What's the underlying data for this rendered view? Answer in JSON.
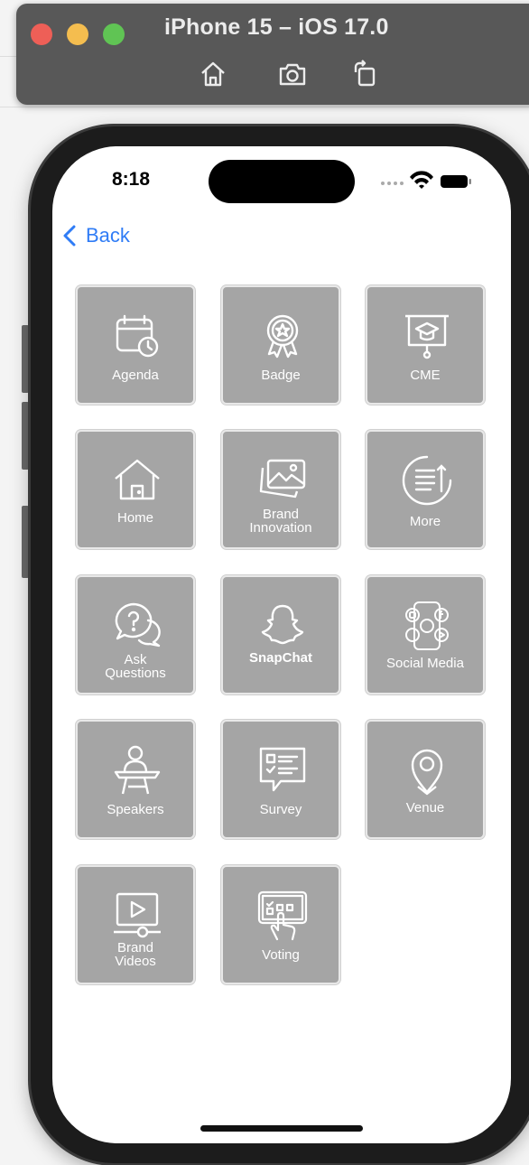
{
  "simulator": {
    "title": "iPhone 15 – iOS 17.0",
    "toolbar": [
      "home-icon",
      "screenshot-icon",
      "rotate-icon"
    ]
  },
  "status_bar": {
    "time": "8:18"
  },
  "nav": {
    "back_label": "Back"
  },
  "tiles": [
    {
      "label": "Agenda",
      "icon": "calendar-clock-icon"
    },
    {
      "label": "Badge",
      "icon": "badge-ribbon-icon"
    },
    {
      "label": "CME",
      "icon": "presentation-board-icon"
    },
    {
      "label": "Home",
      "icon": "house-icon"
    },
    {
      "label": "Brand Innovation",
      "icon": "image-gallery-icon"
    },
    {
      "label": "More",
      "icon": "menu-more-icon"
    },
    {
      "label": "Ask Questions",
      "icon": "question-chat-icon"
    },
    {
      "label": "SnapChat",
      "icon": "snapchat-ghost-icon"
    },
    {
      "label": "Social Media",
      "icon": "social-phone-icon"
    },
    {
      "label": "Speakers",
      "icon": "speaker-podium-icon"
    },
    {
      "label": "Survey",
      "icon": "survey-checklist-icon"
    },
    {
      "label": "Venue",
      "icon": "location-pin-icon"
    },
    {
      "label": "Brand Videos",
      "icon": "video-player-icon"
    },
    {
      "label": "Voting",
      "icon": "voting-hand-icon"
    }
  ],
  "colors": {
    "tile": "#a5a5a5",
    "accent": "#2f7cf6"
  }
}
